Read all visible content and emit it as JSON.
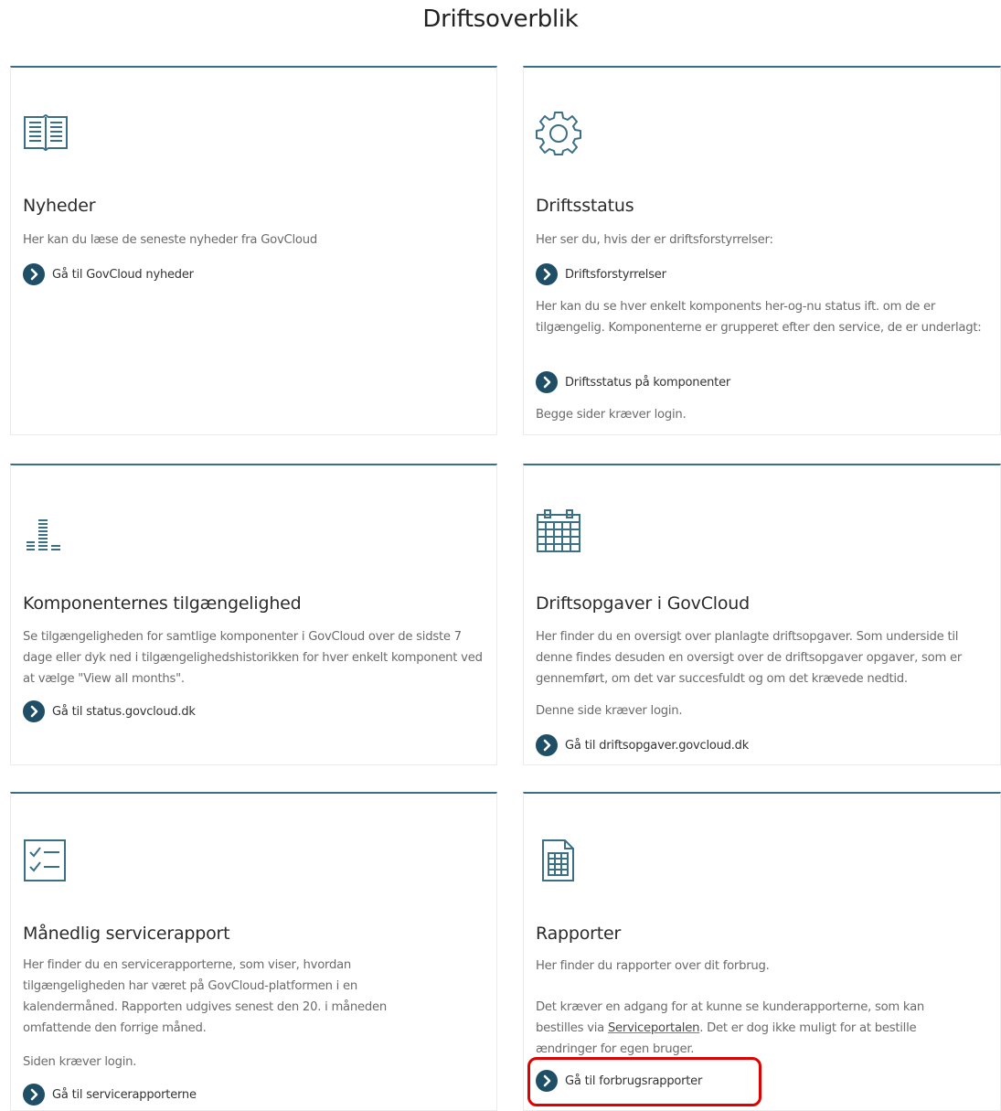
{
  "page": {
    "title": "Driftsoverblik"
  },
  "colors": {
    "accent": "#3a6f84",
    "link_icon": "#1f4f66",
    "highlight": "#e00000"
  },
  "cards": {
    "nyheder": {
      "icon": "book-icon",
      "title": "Nyheder",
      "desc": "Her kan du læse de seneste nyheder fra GovCloud",
      "link": "Gå til GovCloud nyheder"
    },
    "driftsstatus": {
      "icon": "gear-icon",
      "title": "Driftsstatus",
      "desc1": "Her ser du, hvis der er driftsforstyrrelser:",
      "link1": "Driftsforstyrrelser",
      "desc2": "Her kan du se hver enkelt komponents her-og-nu status ift. om de er tilgængelig. Komponenterne er grupperet efter den service, de er underlagt:",
      "link2": "Driftsstatus på komponenter",
      "note": "Begge sider kræver login."
    },
    "tilgaengelighed": {
      "icon": "bar-chart-icon",
      "title": "Komponenternes tilgængelighed",
      "desc": "Se tilgængeligheden for samtlige komponenter i GovCloud over de sidste 7 dage eller dyk ned i tilgængelighedshistorikken for hver enkelt komponent ved at vælge \"View all months\".",
      "link": "Gå til status.govcloud.dk"
    },
    "driftsopgaver": {
      "icon": "calendar-icon",
      "title": "Driftsopgaver i GovCloud",
      "desc": "Her finder du en oversigt over planlagte driftsopgaver. Som underside til denne findes desuden en oversigt over de driftsopgaver opgaver, som er gennemført, om det var succesfuldt og om det krævede nedtid.",
      "note": "Denne side kræver login.",
      "link": "Gå til driftsopgaver.govcloud.dk"
    },
    "servicerapport": {
      "icon": "checklist-icon",
      "title": "Månedlig servicerapport",
      "desc": "Her finder du en servicerapporterne, som viser, hvordan tilgængeligheden har været på GovCloud-platformen i en kalendermåned. Rapporten udgives senest den 20. i måneden omfattende den forrige måned.",
      "note": "Siden kræver login.",
      "link": "Gå til servicerapporterne"
    },
    "rapporter": {
      "icon": "spreadsheet-icon",
      "title": "Rapporter",
      "desc": "Her finder du rapporter over dit forbrug.",
      "desc2_a": "Det kræver en adgang for at kunne se kunderapporterne, som kan bestilles via ",
      "desc2_link": "Serviceportalen",
      "desc2_b": ". Det er dog ikke muligt for at bestille ændringer for egen bruger.",
      "link": "Gå til forbrugsrapporter"
    }
  }
}
